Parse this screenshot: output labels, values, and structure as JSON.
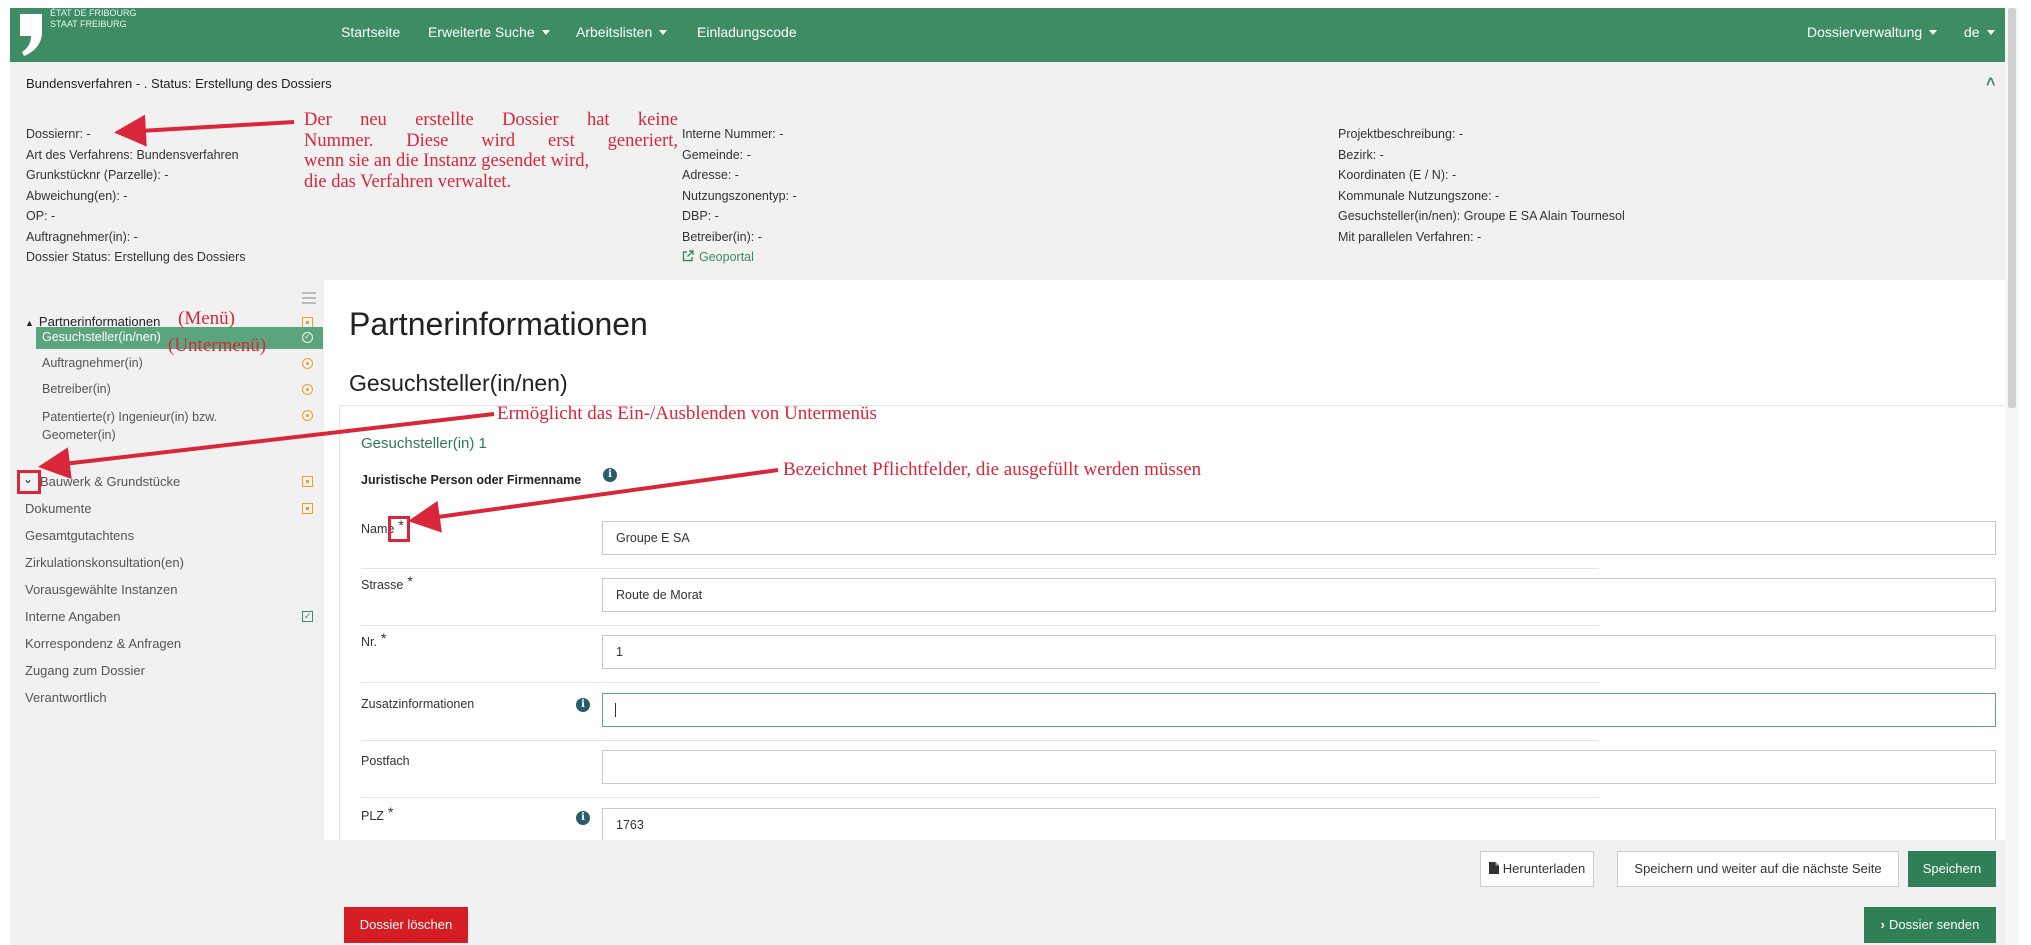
{
  "brand": {
    "line1": "ÉTAT DE FRIBOURG",
    "line2": "STAAT FREIBURG"
  },
  "nav": {
    "home": "Startseite",
    "advanced_search": "Erweiterte Suche",
    "worklists": "Arbeitslisten",
    "invite_code": "Einladungscode",
    "dossier_admin": "Dossierverwaltung",
    "lang": "de"
  },
  "header": {
    "status_line": "Bundensverfahren - . Status: Erstellung des Dossiers",
    "col1": [
      "Dossiernr: -",
      "Art des Verfahrens: Bundensverfahren",
      "Grunkstücknr (Parzelle): -",
      "Abweichung(en): -",
      "OP: -",
      "Auftragnehmer(in): -",
      "Dossier Status: Erstellung des Dossiers"
    ],
    "col2": [
      "Interne Nummer: -",
      "Gemeinde: -",
      "Adresse: -",
      "Nutzungszonentyp: -",
      "DBP: -",
      "Betreiber(in): -"
    ],
    "geoportal": "Geoportal",
    "col3": [
      "Projektbeschreibung: -",
      "Bezirk: -",
      "Koordinaten (E / N): -",
      "Kommunale Nutzungszone: -",
      "Gesuchsteller(in/nen): Groupe E SA Alain Tournesol",
      "Mit parallelen Verfahren: -"
    ]
  },
  "annotations": {
    "dossier_note_lines": [
      "Der neu erstellte Dossier hat keine",
      "Nummer. Diese wird erst generiert,",
      "wenn sie an die Instanz gesendet wird,",
      "die das Verfahren verwaltet."
    ],
    "menu": "(Menü)",
    "submenu": "(Untermenü)",
    "toggle_note": "Ermöglicht das Ein-/Ausblenden von Untermenüs",
    "required_note": "Bezeichnet Pflichtfelder, die ausgefüllt werden müssen"
  },
  "sidebar": {
    "group_partner": "Partnerinformationen",
    "sub_items": [
      "Gesuchsteller(in/nen)",
      "Auftragnehmer(in)",
      "Betreiber(in)",
      "Patentierte(r) Ingenieur(in) bzw.",
      "Geometer(in)"
    ],
    "items": [
      "Bauwerk & Grundstücke",
      "Dokumente",
      "Gesamtgutachtens",
      "Zirkulationskonsultation(en)",
      "Vorausgewählte Instanzen",
      "Interne Angaben",
      "Korrespondenz & Anfragen",
      "Zugang zum Dossier",
      "Verantwortlich"
    ]
  },
  "main": {
    "title": "Partnerinformationen",
    "subtitle": "Gesuchsteller(in/nen)",
    "section": "Gesuchsteller(in) 1",
    "legal_label": "Juristische Person oder Firmenname",
    "required_mark": "*",
    "fields": [
      {
        "label": "Name",
        "value": "Groupe E SA"
      },
      {
        "label": "Strasse",
        "value": "Route de Morat"
      },
      {
        "label": "Nr.",
        "value": "1"
      },
      {
        "label": "Zusatzinformationen",
        "value": ""
      },
      {
        "label": "Postfach",
        "value": ""
      },
      {
        "label": "PLZ",
        "value": "1763"
      }
    ]
  },
  "buttons": {
    "download": "Herunterladen",
    "save_next": "Speichern und weiter auf die nächste Seite",
    "save": "Speichern",
    "delete": "Dossier löschen",
    "send": "Dossier senden"
  },
  "colors": {
    "nav": "#3d8c63",
    "accent_green": "#2f7f57",
    "danger": "#d41e24",
    "annotation": "#d9263a",
    "warn_icon": "#e0a42a"
  },
  "icons": [
    "logo-comma-icon",
    "caret-down-icon",
    "chevron-up-icon",
    "external-link-icon",
    "menu-toggle-icon",
    "chevron-down-icon",
    "status-square-icon",
    "status-circle-icon",
    "check-circle-icon",
    "check-square-icon",
    "info-icon",
    "pdf-icon",
    "chevron-right-icon"
  ]
}
